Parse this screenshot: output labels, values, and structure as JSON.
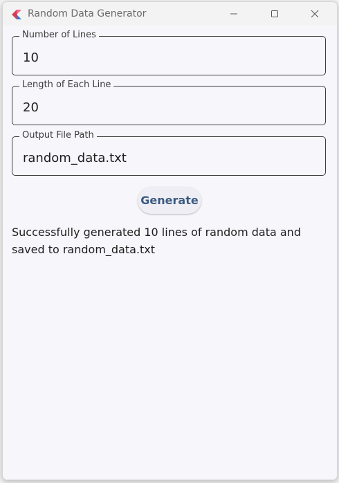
{
  "window": {
    "title": "Random Data Generator",
    "icon": "flutter-app-icon"
  },
  "form": {
    "lines": {
      "label": "Number of Lines",
      "value": "10"
    },
    "length": {
      "label": "Length of Each Line",
      "value": "20"
    },
    "path": {
      "label": "Output File Path",
      "value": "random_data.txt"
    }
  },
  "actions": {
    "generate_label": "Generate"
  },
  "status": {
    "message": "Successfully generated 10 lines of random data and saved to random_data.txt"
  },
  "colors": {
    "accent": "#3a5a80",
    "window_bg": "#f6f6fb",
    "border": "#3d3d3d"
  }
}
